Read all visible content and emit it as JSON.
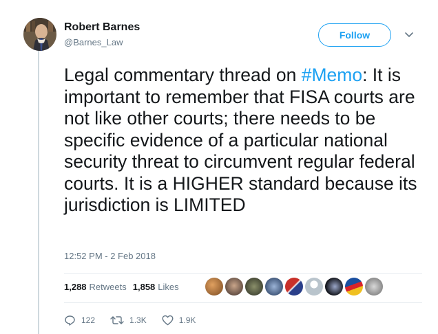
{
  "tweet": {
    "author_name": "Robert Barnes",
    "author_handle": "@Barnes_Law",
    "follow_label": "Follow",
    "text_before": "Legal commentary thread on ",
    "hashtag": "#Memo",
    "text_after": ": It is important to remember that FISA courts are not like other courts; there needs to be specific evidence of a particular national security threat to circumvent regular federal courts. It is a HIGHER standard because its jurisdiction is LIMITED",
    "timestamp": "12:52 PM - 2 Feb 2018"
  },
  "stats": {
    "retweets_count": "1,288",
    "retweets_label": "Retweets",
    "likes_count": "1,858",
    "likes_label": "Likes"
  },
  "actions": {
    "reply_count": "122",
    "retweet_count": "1.3K",
    "like_count": "1.9K"
  },
  "icons": {
    "caret": "chevron-down-icon",
    "reply": "reply-icon",
    "retweet": "retweet-icon",
    "like": "heart-icon"
  },
  "colors": {
    "accent": "#1da1f2",
    "text": "#14171a",
    "muted": "#657786",
    "thread_line": "#cfd9de"
  },
  "likers_count": 9
}
